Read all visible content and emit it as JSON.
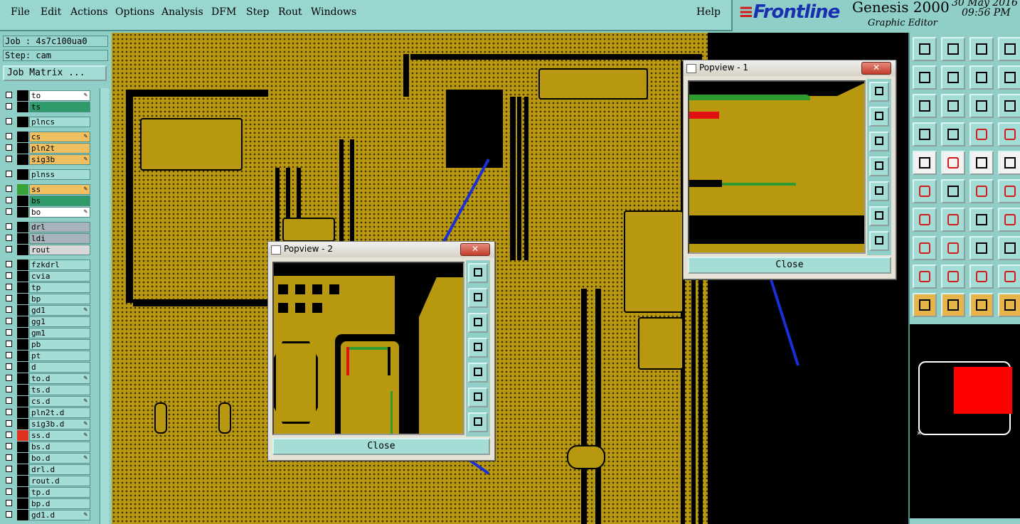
{
  "menu": {
    "items": [
      "File",
      "Edit",
      "Actions",
      "Options",
      "Analysis",
      "DFM",
      "Step",
      "Rout",
      "Windows"
    ],
    "help": "Help"
  },
  "brand": {
    "logo": "Frontline",
    "product": "Genesis 2000",
    "subtitle": "Graphic Editor",
    "date": "30 May 2016",
    "time": "09:56 PM"
  },
  "left_panel": {
    "job": "Job : 4s7c100ua0",
    "step": "Step: cam",
    "job_matrix_label": "Job Matrix ..."
  },
  "layers": [
    {
      "name": "to",
      "color": "#ffffff",
      "swatch": "#000000",
      "mark": "✎"
    },
    {
      "name": "ts",
      "color": "#2f9a6a",
      "swatch": "#000000",
      "mark": ""
    },
    {
      "name": "plncs",
      "color": "#a4dcd6",
      "swatch": "#000000",
      "mark": ""
    },
    {
      "name": "cs",
      "color": "#f0c060",
      "swatch": "#000000",
      "mark": "✎"
    },
    {
      "name": "pln2t",
      "color": "#f0c060",
      "swatch": "#000000",
      "mark": ""
    },
    {
      "name": "sig3b",
      "color": "#f0c060",
      "swatch": "#000000",
      "mark": "✎"
    },
    {
      "name": "plnss",
      "color": "#a4dcd6",
      "swatch": "#000000",
      "mark": ""
    },
    {
      "name": "ss",
      "color": "#f0c060",
      "swatch": "#3aa23a",
      "mark": "✎"
    },
    {
      "name": "bs",
      "color": "#2f9a6a",
      "swatch": "#000000",
      "mark": ""
    },
    {
      "name": "bo",
      "color": "#ffffff",
      "swatch": "#000000",
      "mark": "✎"
    },
    {
      "name": "drl",
      "color": "#a8b4bc",
      "swatch": "#000000",
      "mark": ""
    },
    {
      "name": "ldi",
      "color": "#a8b4bc",
      "swatch": "#000000",
      "mark": ""
    },
    {
      "name": "rout",
      "color": "#d8d8d8",
      "swatch": "#000000",
      "mark": ""
    },
    {
      "name": "fzkdrl",
      "color": "#a4dcd6",
      "swatch": "#000000",
      "mark": ""
    },
    {
      "name": "cvia",
      "color": "#a4dcd6",
      "swatch": "#000000",
      "mark": ""
    },
    {
      "name": "tp",
      "color": "#a4dcd6",
      "swatch": "#000000",
      "mark": ""
    },
    {
      "name": "bp",
      "color": "#a4dcd6",
      "swatch": "#000000",
      "mark": ""
    },
    {
      "name": "gd1",
      "color": "#a4dcd6",
      "swatch": "#000000",
      "mark": "✎"
    },
    {
      "name": "gg1",
      "color": "#a4dcd6",
      "swatch": "#000000",
      "mark": ""
    },
    {
      "name": "gm1",
      "color": "#a4dcd6",
      "swatch": "#000000",
      "mark": ""
    },
    {
      "name": "pb",
      "color": "#a4dcd6",
      "swatch": "#000000",
      "mark": ""
    },
    {
      "name": "pt",
      "color": "#a4dcd6",
      "swatch": "#000000",
      "mark": ""
    },
    {
      "name": "d",
      "color": "#a4dcd6",
      "swatch": "#000000",
      "mark": ""
    },
    {
      "name": "to.d",
      "color": "#a4dcd6",
      "swatch": "#000000",
      "mark": "✎"
    },
    {
      "name": "ts.d",
      "color": "#a4dcd6",
      "swatch": "#000000",
      "mark": ""
    },
    {
      "name": "cs.d",
      "color": "#a4dcd6",
      "swatch": "#000000",
      "mark": "✎"
    },
    {
      "name": "pln2t.d",
      "color": "#a4dcd6",
      "swatch": "#000000",
      "mark": ""
    },
    {
      "name": "sig3b.d",
      "color": "#a4dcd6",
      "swatch": "#000000",
      "mark": "✎"
    },
    {
      "name": "ss.d",
      "color": "#a4dcd6",
      "swatch": "#e03020",
      "mark": "✎"
    },
    {
      "name": "bs.d",
      "color": "#a4dcd6",
      "swatch": "#000000",
      "mark": ""
    },
    {
      "name": "bo.d",
      "color": "#a4dcd6",
      "swatch": "#000000",
      "mark": "✎"
    },
    {
      "name": "drl.d",
      "color": "#a4dcd6",
      "swatch": "#000000",
      "mark": ""
    },
    {
      "name": "rout.d",
      "color": "#a4dcd6",
      "swatch": "#000000",
      "mark": ""
    },
    {
      "name": "tp.d",
      "color": "#a4dcd6",
      "swatch": "#000000",
      "mark": ""
    },
    {
      "name": "bp.d",
      "color": "#a4dcd6",
      "swatch": "#000000",
      "mark": ""
    },
    {
      "name": "gd1.d",
      "color": "#a4dcd6",
      "swatch": "#000000",
      "mark": "✎"
    }
  ],
  "popview1": {
    "title": "Popview - 1",
    "close_label": "Close",
    "x_label": "✕"
  },
  "popview2": {
    "title": "Popview - 2",
    "close_label": "Close",
    "x_label": "✕"
  },
  "toolbar_icons": [
    "clipboard-icon",
    "save-icon",
    "home-icon",
    "window-icon",
    "step-left-icon",
    "step-right-icon",
    "swap-icon",
    "route-icon",
    "fit-icon",
    "center-icon",
    "one-to-two-icon",
    "help-icon",
    "tools-icon",
    "grid-icon",
    "layers-icon",
    "measure-icon",
    "pointer-icon",
    "draw-icon",
    "ruler-icon",
    "box-select-icon",
    "net-icon",
    "cross-icon",
    "move-icon",
    "copy-icon",
    "line-icon",
    "slash-icon",
    "undo-icon",
    "flag-icon",
    "point-icon",
    "minus-icon",
    "resize-icon",
    "group-icon",
    "triangle-icon",
    "delta-icon",
    "arch-icon",
    "arc-icon",
    "select-icon",
    "select-box-icon",
    "select-inside-icon",
    "snap-icon"
  ],
  "colors": {
    "panel": "#8fcfc8",
    "copper": "#b8980e",
    "highlight": "#ff0000",
    "annotation_arrow": "#1a2fd6"
  }
}
